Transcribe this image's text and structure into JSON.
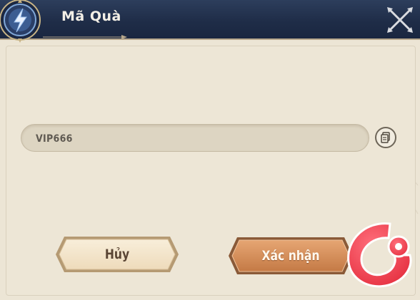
{
  "dialog": {
    "title": "Mã Quà",
    "code_input": {
      "value": "VIP666"
    },
    "cancel_label": "Hủy",
    "confirm_label": "Xác nhận"
  },
  "colors": {
    "header": "#1f2d48",
    "panel": "#ece5d5",
    "confirm_button": "#d58f5a",
    "cancel_button": "#f3e3c8",
    "watermark": "#e9303f"
  },
  "icons": [
    "lightning-emblem-icon",
    "close-icon",
    "paste-icon",
    "game-logo-icon"
  ]
}
